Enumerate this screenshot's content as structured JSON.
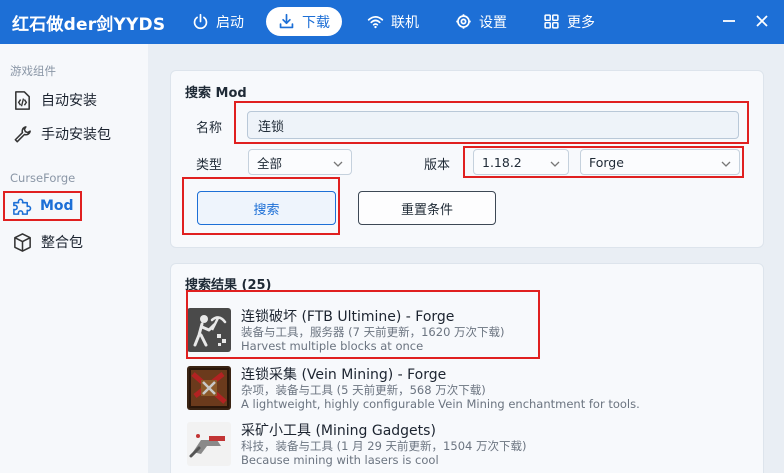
{
  "app": {
    "title": "红石做der剑YYDS"
  },
  "nav": [
    {
      "label": "启动",
      "icon": "power-icon"
    },
    {
      "label": "下载",
      "icon": "download-icon",
      "active": true
    },
    {
      "label": "联机",
      "icon": "wifi-icon"
    },
    {
      "label": "设置",
      "icon": "gear-icon"
    },
    {
      "label": "更多",
      "icon": "grid-icon"
    }
  ],
  "sidebar": {
    "groups": [
      {
        "label": "游戏组件"
      },
      {
        "label": "CurseForge"
      }
    ],
    "items": [
      {
        "label": "自动安装",
        "icon": "code-file-icon"
      },
      {
        "label": "手动安装包",
        "icon": "wrench-icon"
      },
      {
        "label": "Mod",
        "icon": "puzzle-icon",
        "active": true
      },
      {
        "label": "整合包",
        "icon": "box-icon"
      }
    ]
  },
  "search": {
    "title": "搜索 Mod",
    "name_label": "名称",
    "name_value": "连锁",
    "type_label": "类型",
    "type_value": "全部",
    "version_label": "版本",
    "version_value": "1.18.2",
    "loader_value": "Forge",
    "search_button": "搜索",
    "reset_button": "重置条件"
  },
  "results": {
    "title": "搜索结果 (25)",
    "items": [
      {
        "title": "连锁破坏 (FTB Ultimine) - Forge",
        "meta": "装备与工具，服务器 (7 天前更新，1620 万次下载)",
        "desc": "Harvest multiple blocks at once"
      },
      {
        "title": "连锁采集 (Vein Mining) - Forge",
        "meta": "杂项，装备与工具 (5 天前更新，568 万次下载)",
        "desc": "A lightweight, highly configurable Vein Mining enchantment for tools."
      },
      {
        "title": "采矿小工具 (Mining Gadgets)",
        "meta": "科技，装备与工具 (1 月 29 天前更新，1504 万次下载)",
        "desc": "Because mining with lasers is cool"
      }
    ]
  },
  "colors": {
    "accent": "#1d6fd6",
    "highlight": "#e02020"
  }
}
